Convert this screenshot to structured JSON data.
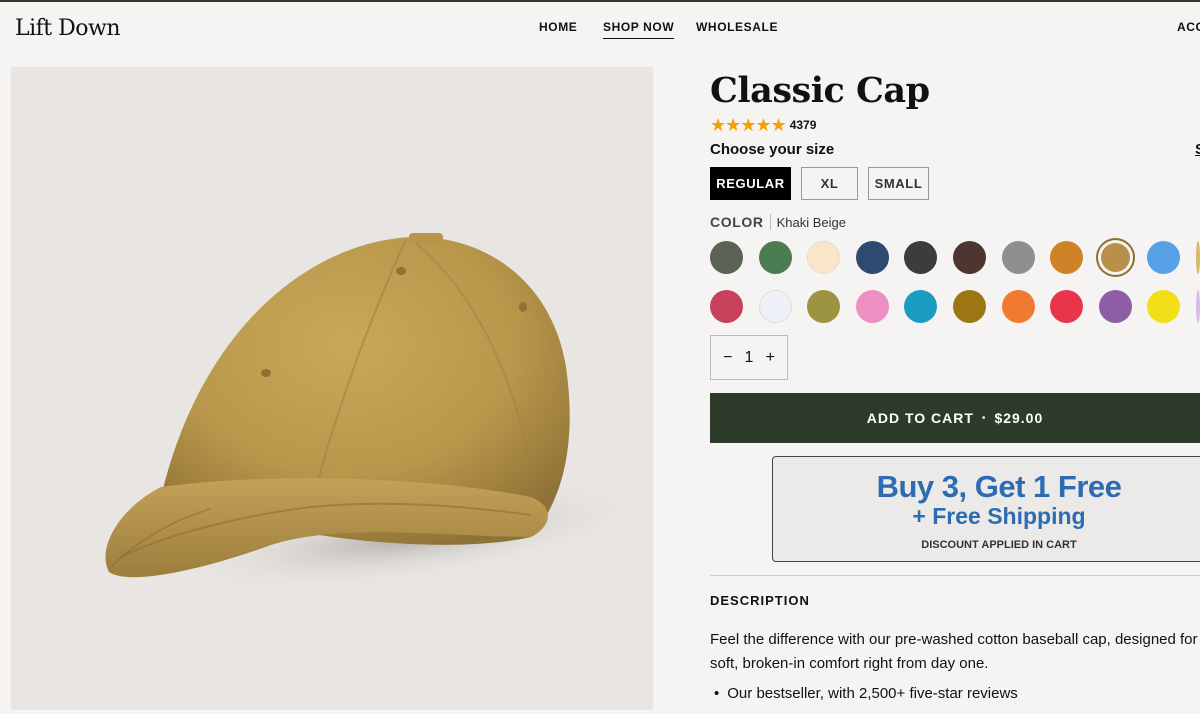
{
  "brand": {
    "logo": "Lift Down"
  },
  "nav": {
    "home": "HOME",
    "shop": "SHOP NOW",
    "wholesale": "WHOLESALE",
    "account": "ACC"
  },
  "product": {
    "title": "Classic Cap",
    "rating": {
      "stars": 4.5,
      "star_glyphs": "★★★★★",
      "count": "4379"
    },
    "size_label": "Choose your size",
    "size_guide": "S",
    "sizes": [
      {
        "label": "REGULAR",
        "selected": true
      },
      {
        "label": "XL",
        "selected": false
      },
      {
        "label": "SMALL",
        "selected": false
      }
    ],
    "color_label": "COLOR",
    "color_value": "Khaki Beige",
    "swatches_row1": [
      "#5b6354",
      "#4a7d52",
      "#fbe5c8",
      "#2f4a70",
      "#3b3c3c",
      "#4e3530",
      "#8f8f8d",
      "#cf8326",
      "#b8904a",
      "#57a2e6",
      "#d9b86a"
    ],
    "swatches_row2": [
      "#c8405b",
      "#eef0f8",
      "#9c9440",
      "#ee8fc1",
      "#1a9dc1",
      "#9c7615",
      "#f07a30",
      "#e8354b",
      "#8d5ea6",
      "#f3df17",
      "#d8b9e8"
    ],
    "selected_swatch": 8,
    "quantity": {
      "minus": "−",
      "value": "1",
      "plus": "+"
    },
    "add_to_cart": {
      "label": "ADD TO CART",
      "sep": "•",
      "price": "$29.00"
    },
    "promo": {
      "line1": "Buy 3, Get 1 Free",
      "line2": "+ Free Shipping",
      "line3": "DISCOUNT APPLIED IN CART"
    },
    "description_heading": "DESCRIPTION",
    "description_text": "Feel the difference with our pre-washed cotton baseball cap, designed for soft, broken-in comfort right from day one.",
    "bullets": [
      "Our bestseller, with 2,500+ five-star reviews"
    ]
  },
  "colors": {
    "accent": "#2d3b2a",
    "star": "#f2a200",
    "promo_text": "#2d6cb3"
  }
}
